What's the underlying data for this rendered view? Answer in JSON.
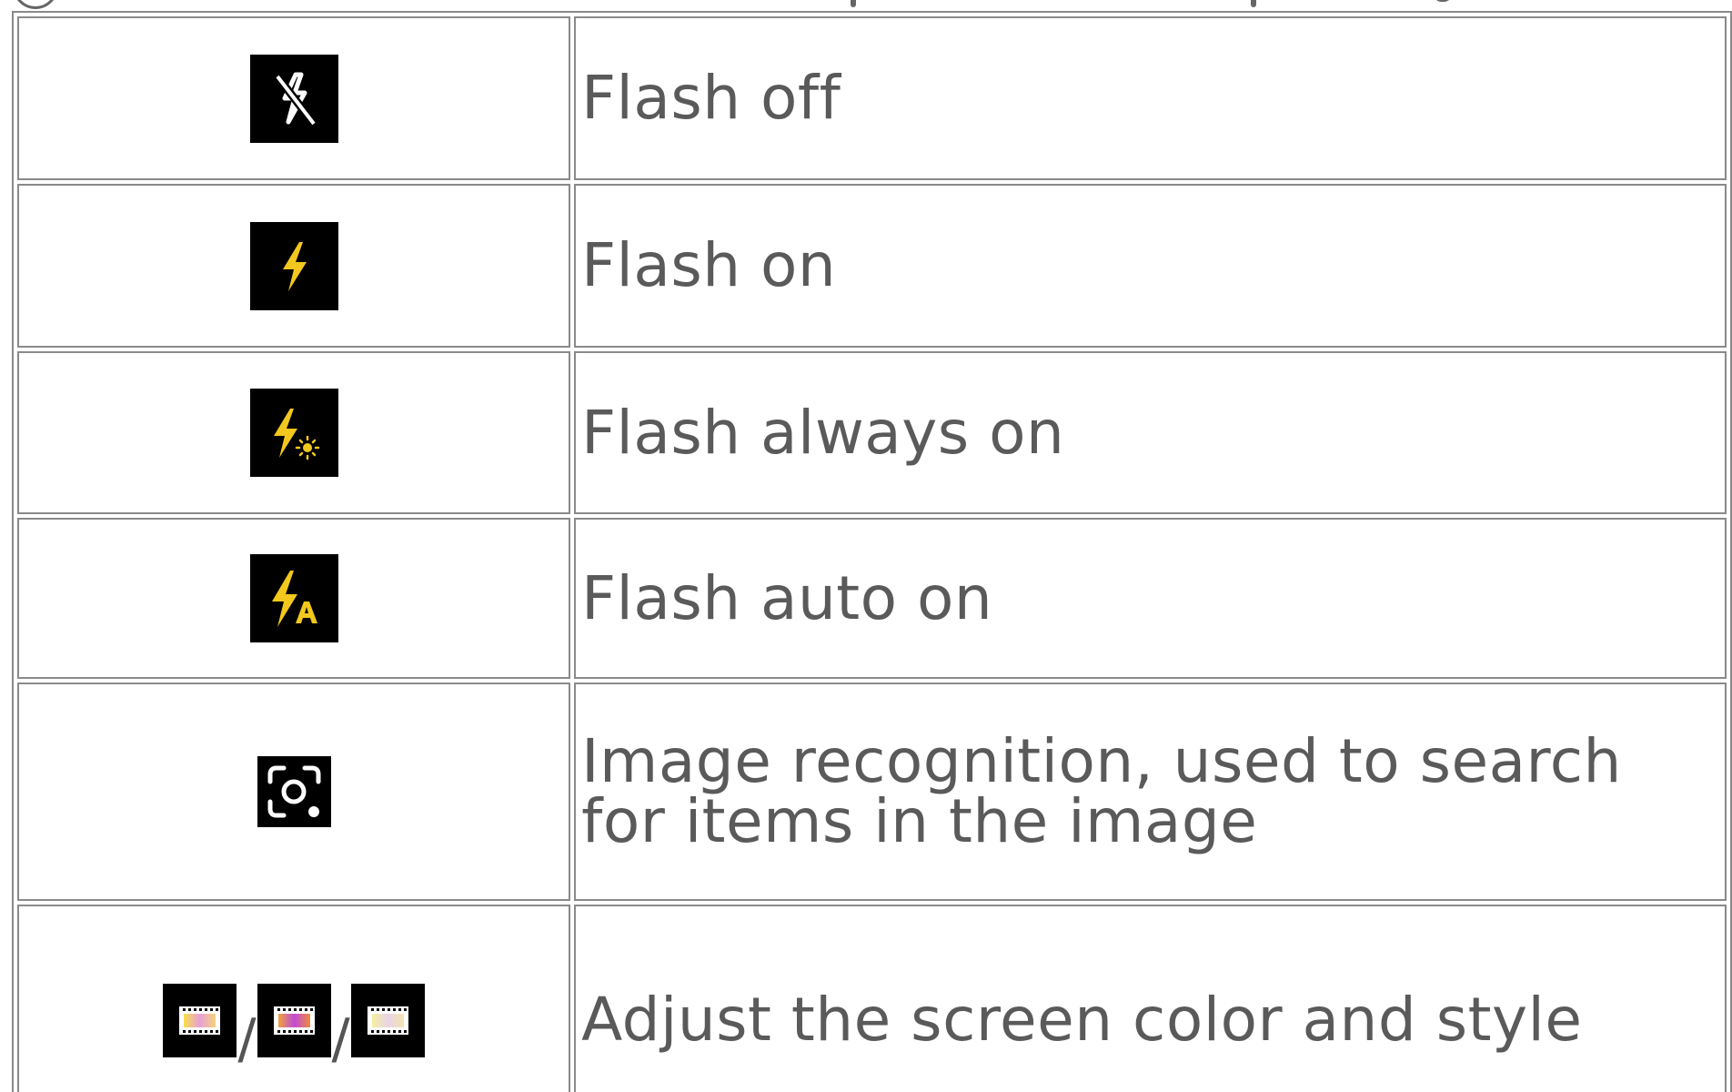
{
  "rows": [
    {
      "icon": "flash-off-icon",
      "description": "Flash off"
    },
    {
      "icon": "flash-on-icon",
      "description": "Flash on"
    },
    {
      "icon": "flash-always-on-icon",
      "description": "Flash always on"
    },
    {
      "icon": "flash-auto-icon",
      "description": "Flash auto on"
    },
    {
      "icon": "image-recognition-icon",
      "description": "Image recognition, used to search for items in the image"
    },
    {
      "icon": "screen-color-style-icon",
      "description": "Adjust the screen color and style",
      "separator": "/"
    }
  ],
  "colors": {
    "icon_background": "#000000",
    "flash_yellow": "#F2C81E",
    "text": "#5A5A5A",
    "border": "#8A8A8A"
  }
}
